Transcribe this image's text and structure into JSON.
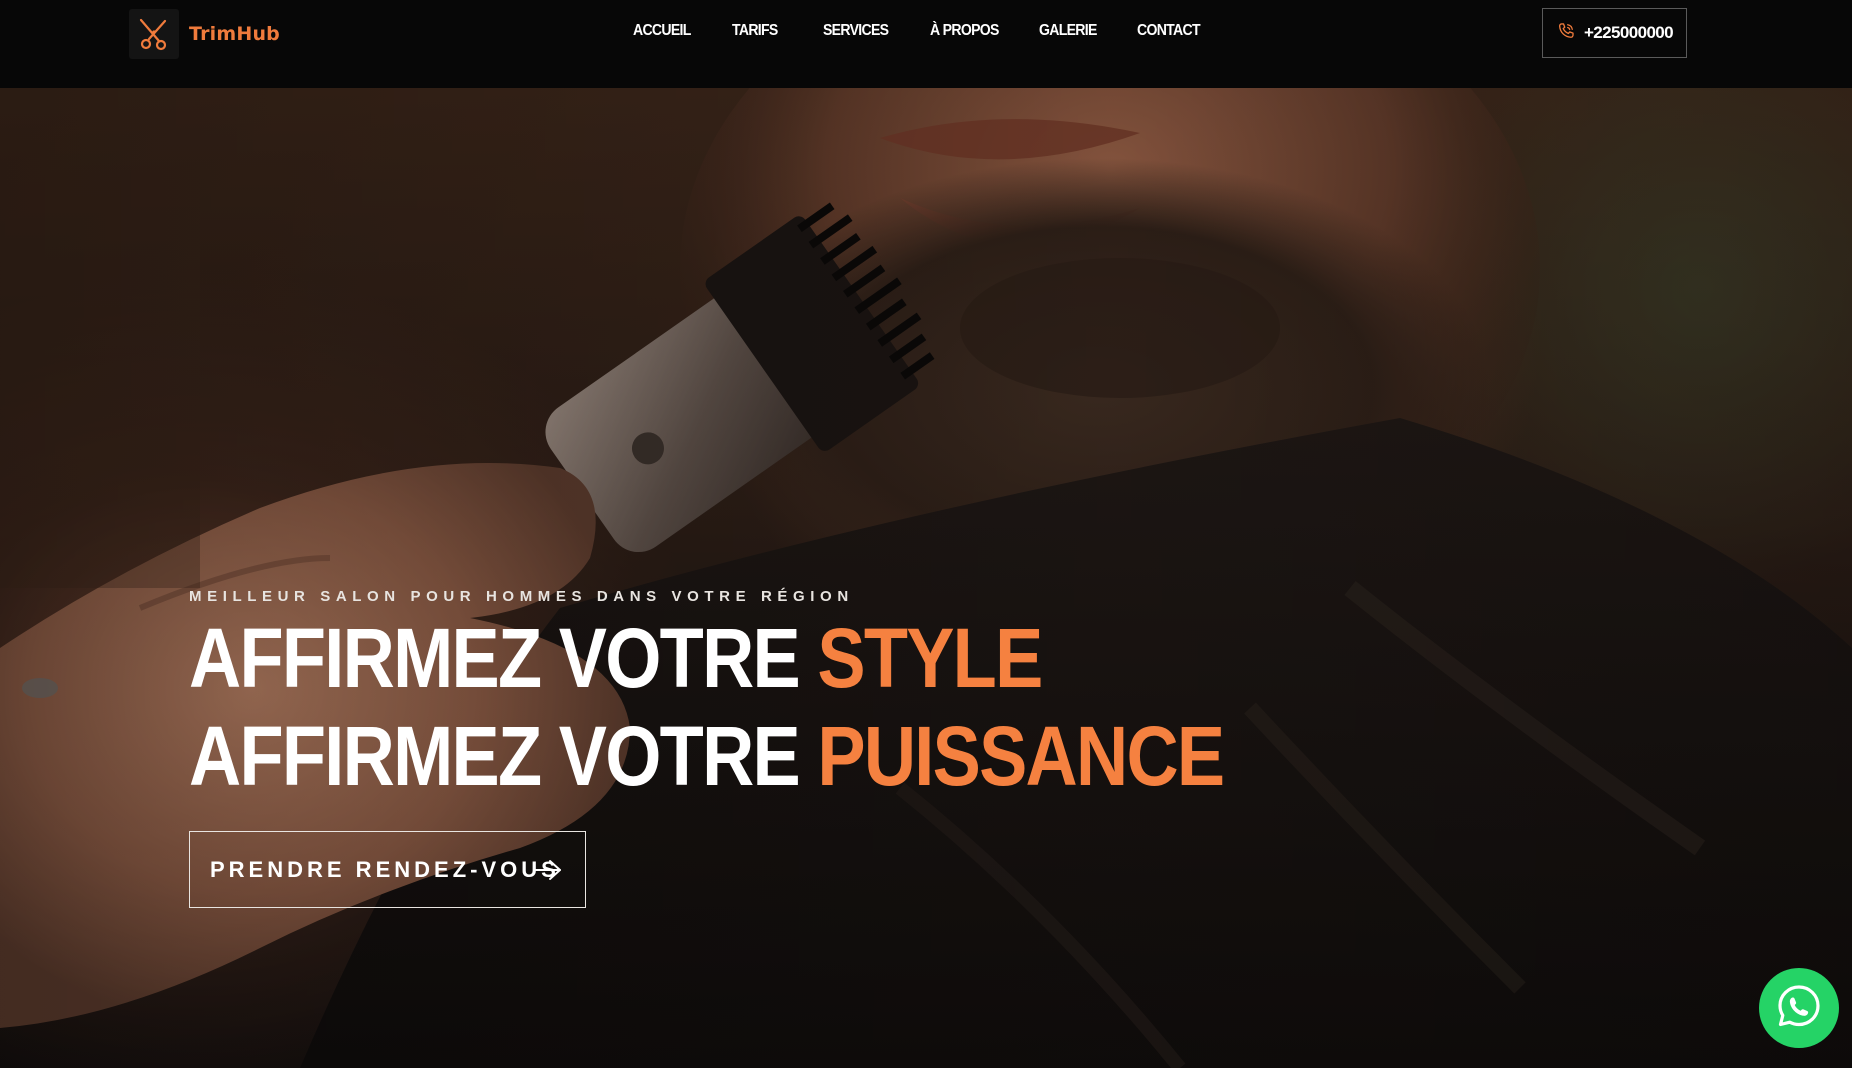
{
  "brand": {
    "name": "TrimHub",
    "logo_icon": "scissors-icon",
    "accent_color": "#f07b3c"
  },
  "nav": {
    "items": [
      {
        "label": "ACCUEIL"
      },
      {
        "label": "TARIFS"
      },
      {
        "label": "SERVICES"
      },
      {
        "label": "À PROPOS"
      },
      {
        "label": "GALERIE"
      },
      {
        "label": "CONTACT"
      }
    ],
    "phone": {
      "icon": "phone-icon",
      "label": "+225000000"
    }
  },
  "hero": {
    "eyebrow": "MEILLEUR SALON POUR HOMMES DANS VOTRE RÉGION",
    "line1_prefix": "AFFIRMEZ VOTRE",
    "line1_accent": "STYLE",
    "line2_prefix": "AFFIRMEZ VOTRE",
    "line2_accent": "PUISSANCE",
    "accent_color": "#f58140",
    "cta": {
      "label": "PRENDRE RENDEZ-VOUS",
      "icon": "arrow-right-icon"
    }
  },
  "floating": {
    "whatsapp_icon": "whatsapp-icon",
    "color": "#25d366"
  }
}
